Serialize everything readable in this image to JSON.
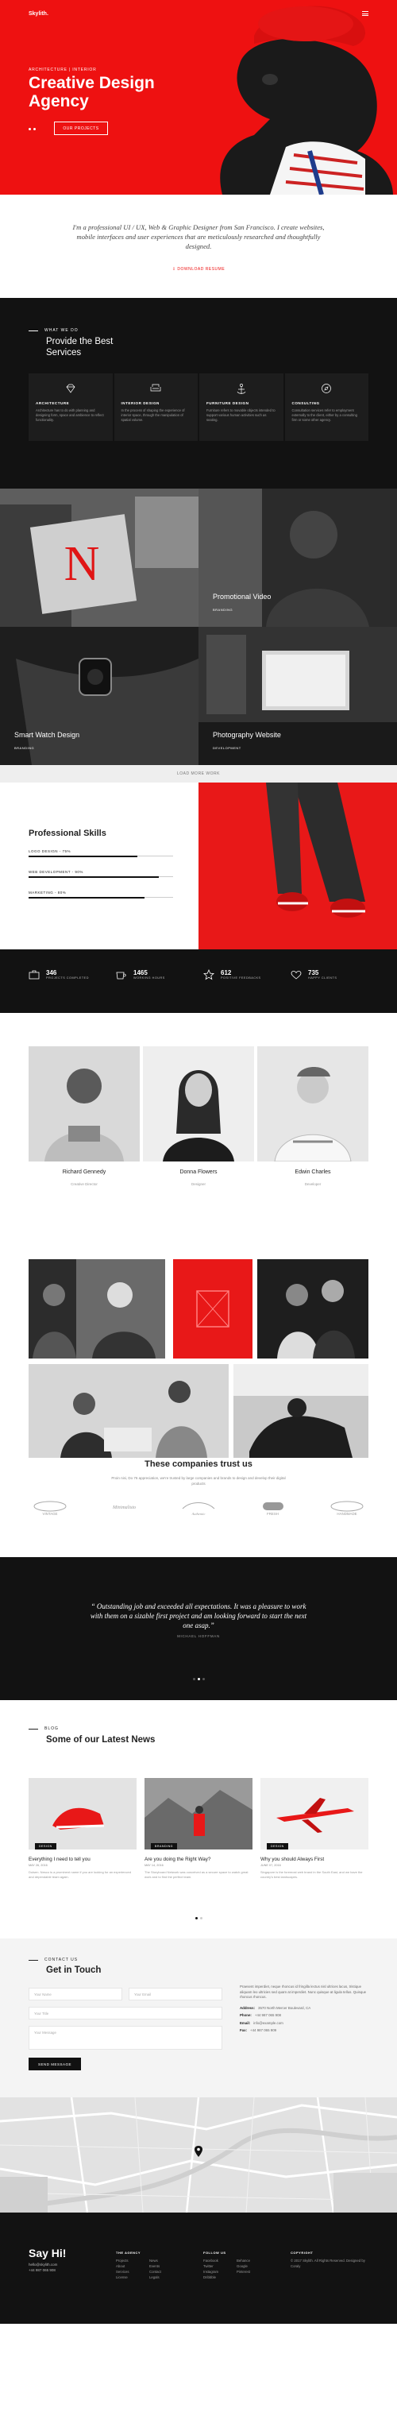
{
  "header": {
    "logo": "Skylith.",
    "menu_icon": "hamburger-icon"
  },
  "hero": {
    "kicker": "ARCHITECTURE | INTERIOR",
    "title": "Creative Design Agency",
    "button": "OUR PROJECTS",
    "bg": "#ee1111"
  },
  "intro": {
    "text": "I'm a professional UI / UX, Web & Graphic Designer from San Francisco. I create websites, mobile interfaces and user experiences that are meticulously researched and thoughtfully designed.",
    "download": "DOWNLOAD RESUME"
  },
  "services": {
    "label": "WHAT WE DO",
    "title": "Provide the Best Services",
    "items": [
      {
        "icon": "diamond-icon",
        "title": "ARCHITECTURE",
        "text": "Architecture has to do with planning and designing form, space and ambience to reflect functionality."
      },
      {
        "icon": "sofa-icon",
        "title": "INTERIOR DESIGN",
        "text": "In the process of shaping the experience of interior space, through the manipulation of spatial volume."
      },
      {
        "icon": "anchor-icon",
        "title": "FURNITURE DESIGN",
        "text": "Furniture refers to movable objects intended to support various human activities such as seating."
      },
      {
        "icon": "compass-icon",
        "title": "CONSULTING",
        "text": "Consultation services refer to employment externally to the client, either by a consulting firm or some other agency."
      }
    ]
  },
  "portfolio": {
    "items": [
      {
        "title": "Promotional Video",
        "tag": "BRANDING"
      },
      {
        "title": "Smart Watch Design",
        "tag": "BRANDING"
      },
      {
        "title": "Photography Website",
        "tag": "DEVELOPMENT"
      }
    ],
    "more": "LOAD MORE WORK"
  },
  "skills": {
    "title": "Professional Skills",
    "items": [
      {
        "label": "LOGO DESIGN - 75%",
        "value": 0.75
      },
      {
        "label": "WEB DEVELOPMENT - 90%",
        "value": 0.9
      },
      {
        "label": "MARKETING - 80%",
        "value": 0.8
      }
    ]
  },
  "stats": [
    {
      "icon": "briefcase-icon",
      "num": "346",
      "label": "PROJECTS COMPLETED"
    },
    {
      "icon": "coffee-icon",
      "num": "1465",
      "label": "WORKING HOURS"
    },
    {
      "icon": "star-icon",
      "num": "612",
      "label": "POSITIVE FEEDBACKS"
    },
    {
      "icon": "heart-icon",
      "num": "735",
      "label": "HAPPY CLIENTS"
    }
  ],
  "team": [
    {
      "name": "Richard Gennedy",
      "role": "Creative Director"
    },
    {
      "name": "Donna Flowers",
      "role": "Designer"
    },
    {
      "name": "Edwin Charles",
      "role": "Developer"
    }
  ],
  "clients": {
    "title": "These companies trust us",
    "text": "Proin nisi, Do 76 appreciation, we're trusted by large companies and brands to design and develop their digital products",
    "logos": [
      "VINTAGE",
      "Minimalisto",
      "Authentic",
      "FRESH",
      "HANDMADE"
    ]
  },
  "testimonial": {
    "quote": "“ Outstanding job and exceeded all expectations. It was a pleasure to work with them on a sizable first project and am looking forward to start the next one asap.”",
    "author": "MICHAEL HOFFMAN"
  },
  "blog": {
    "label": "BLOG",
    "title": "Some of our Latest News",
    "posts": [
      {
        "tag": "DESIGN",
        "title": "Everything I need to tell you",
        "date": "MAY 26, 2016",
        "text": "Duisen. Nesco is a prominent name if you are looking for an experienced and dependable team again."
      },
      {
        "tag": "BRANDING",
        "title": "Are you doing the Right Way?",
        "date": "MAY 14, 2016",
        "text": "The Storyboard Network was conceived as a secure space to watch great work and to find the perfect team."
      },
      {
        "tag": "DESIGN",
        "title": "Why you should Always First",
        "date": "JUNE 07, 2016",
        "text": "Singapore is the foremost web brand in the South East, and we have the country's best landscapes."
      }
    ]
  },
  "contact": {
    "label": "CONTACT US",
    "title": "Get in Touch",
    "placeholders": {
      "name": "Your Name",
      "email": "Your Email",
      "title": "Your Title",
      "message": "Your Message"
    },
    "send": "SEND MESSAGE",
    "info": "Praesent imperdiet, neque rhoncus id fringilla lectus nisl ultrices lacus, tristique aliquam leo ultricies sed quam at imperdiet. Nunc quisque at ligula tellus. Quisque rhoncus rhoncus.",
    "address_label": "Address:",
    "address": "3570 North Mercer Boulevard, CA",
    "phone_label": "Phone:",
    "phone": "+44 987 065 908",
    "email_label": "Email:",
    "email": "info@example.com",
    "fax_label": "Fax:",
    "fax": "+44 987 065 909"
  },
  "footer": {
    "title": "Say Hi!",
    "email": "hello@skylith.com",
    "phone": "+44 987 065 908",
    "agency_title": "THE AGENCY",
    "agency_links": [
      "Projects",
      "About",
      "Services",
      "License",
      "News",
      "Events",
      "Contact",
      "Legals"
    ],
    "follow_title": "FOLLOW US",
    "follow_links": [
      "Facebook",
      "Twitter",
      "Instagram",
      "Dribbble",
      "Behance",
      "Google",
      "Pinterest"
    ],
    "copy_title": "COPYRIGHT",
    "copy": "© 2017 Skylith. All Rights Reserved. Designed by Coraly"
  }
}
